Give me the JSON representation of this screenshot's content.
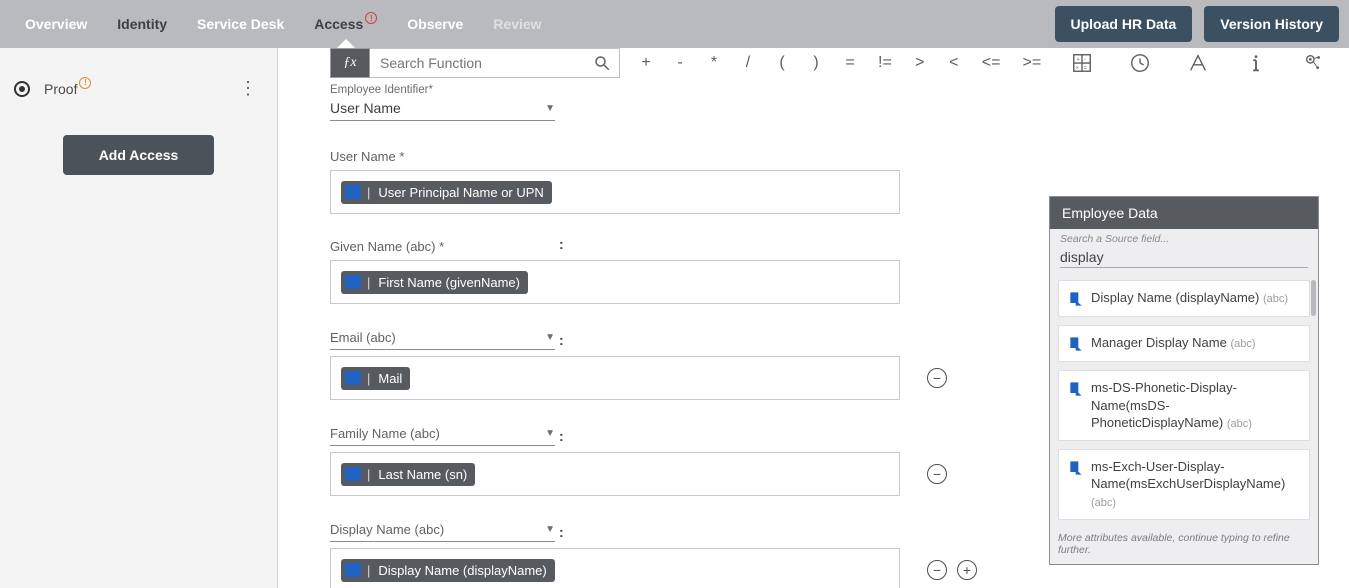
{
  "nav": {
    "tabs": [
      {
        "label": "Overview"
      },
      {
        "label": "Identity"
      },
      {
        "label": "Service Desk"
      },
      {
        "label": "Access"
      },
      {
        "label": "Observe"
      },
      {
        "label": "Review"
      }
    ],
    "actions": {
      "upload": "Upload HR Data",
      "version": "Version History"
    }
  },
  "sidebar": {
    "title": "Proof",
    "add_access": "Add Access"
  },
  "formula": {
    "fx": "ƒx",
    "search_placeholder": "Search Function",
    "ops": [
      "+",
      "-",
      "*",
      "/",
      "(",
      ")",
      "=",
      "!=",
      ">",
      "<",
      "<=",
      ">="
    ]
  },
  "employee_id": {
    "label": "Employee Identifier*",
    "value": "User Name"
  },
  "fields": [
    {
      "label": "User Name *",
      "chip": "User Principal Name or UPN",
      "has_dropdown": false,
      "has_colon": false,
      "minus": false,
      "plus": false
    },
    {
      "label": "Given Name (abc) *",
      "chip": "First Name (givenName)",
      "has_dropdown": false,
      "has_colon": true,
      "minus": false,
      "plus": false
    },
    {
      "label": "Email (abc)",
      "chip": "Mail",
      "has_dropdown": true,
      "has_colon": true,
      "minus": true,
      "plus": false
    },
    {
      "label": "Family Name (abc)",
      "chip": "Last Name (sn)",
      "has_dropdown": true,
      "has_colon": true,
      "minus": true,
      "plus": false
    },
    {
      "label": "Display Name (abc)",
      "chip": "Display Name (displayName)",
      "has_dropdown": true,
      "has_colon": true,
      "minus": true,
      "plus": true
    }
  ],
  "right": {
    "header": "Employee Data",
    "sublabel": "Search a Source field...",
    "search_value": "display",
    "items": [
      {
        "name": "Display Name (displayName)",
        "hint": "(abc)"
      },
      {
        "name": "Manager Display Name",
        "hint": "(abc)"
      },
      {
        "name": "ms-DS-Phonetic-Display-Name(msDS-PhoneticDisplayName)",
        "hint": "(abc)"
      },
      {
        "name": "ms-Exch-User-Display-Name(msExchUserDisplayName)",
        "hint": "(abc)"
      }
    ],
    "footnote": "More attributes available, continue typing to refine further."
  }
}
